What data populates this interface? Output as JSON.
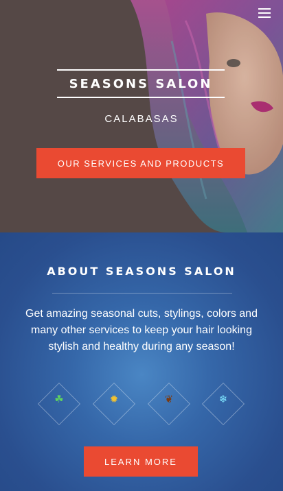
{
  "header": {
    "menu_icon": "hamburger-menu-icon"
  },
  "hero": {
    "title": "SEASONS SALON",
    "subtitle": "CALABASAS",
    "cta_label": "OUR SERVICES AND PRODUCTS",
    "image": "woman-with-multicolored-hair-photo"
  },
  "about": {
    "title": "ABOUT SEASONS SALON",
    "text": "Get amazing seasonal cuts, stylings, colors and many other services to keep your hair looking stylish and healthy during any season!",
    "seasons": [
      {
        "icon": "sprout-icon",
        "glyph": "☘",
        "color": "#5fd35f"
      },
      {
        "icon": "sun-icon",
        "glyph": "✹",
        "color": "#f2c230"
      },
      {
        "icon": "maple-leaf-icon",
        "glyph": "❦",
        "color": "#7a3b12"
      },
      {
        "icon": "snowflake-icon",
        "glyph": "❄",
        "color": "#7fe6ff"
      }
    ],
    "button_label": "LEARN MORE"
  },
  "colors": {
    "accent": "#ea4a32",
    "about_bg": "#2a4f8f"
  }
}
